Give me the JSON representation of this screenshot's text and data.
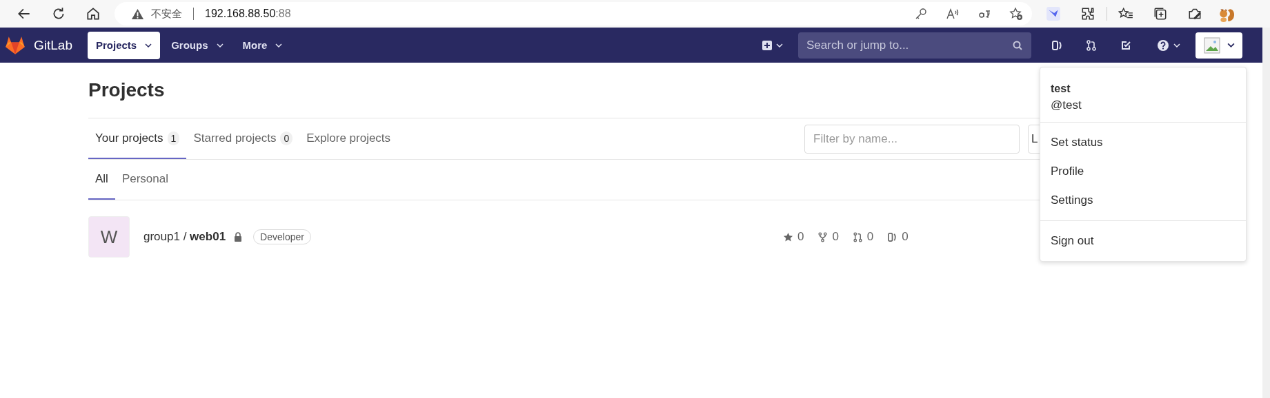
{
  "browser": {
    "security_label": "不安全",
    "url_host": "192.168.88.50",
    "url_port": ":88"
  },
  "navbar": {
    "brand": "GitLab",
    "menus": [
      {
        "label": "Projects",
        "selected": true
      },
      {
        "label": "Groups",
        "selected": false
      },
      {
        "label": "More",
        "selected": false
      }
    ],
    "search": {
      "placeholder": "Search or jump to..."
    }
  },
  "page": {
    "title": "Projects",
    "tabs": [
      {
        "label": "Your projects",
        "count": "1",
        "selected": true
      },
      {
        "label": "Starred projects",
        "count": "0",
        "selected": false
      },
      {
        "label": "Explore projects",
        "selected": false
      }
    ],
    "filter": {
      "placeholder": "Filter by name..."
    },
    "sort_dropdown": {
      "label": "L"
    },
    "subtabs": [
      {
        "label": "All",
        "selected": true
      },
      {
        "label": "Personal",
        "selected": false
      }
    ],
    "projects": [
      {
        "avatar_letter": "W",
        "namespace": "group1 /",
        "name": "web01",
        "private": true,
        "role": "Developer",
        "star_count": "0",
        "fork_count": "0",
        "merge_request_count": "0",
        "issue_count": "0"
      }
    ]
  },
  "user_menu": {
    "name": "test",
    "handle": "@test",
    "sections": [
      [
        "Set status",
        "Profile",
        "Settings"
      ],
      [
        "Sign out"
      ]
    ]
  }
}
